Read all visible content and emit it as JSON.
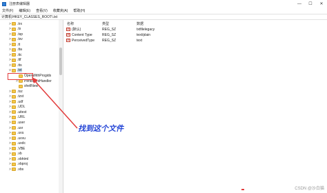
{
  "window": {
    "title": "注册表编辑器",
    "controls": {
      "minimize": "—",
      "maximize": "☐",
      "close": "✕"
    }
  },
  "menu": [
    "文件(F)",
    "编辑(E)",
    "查看(V)",
    "收藏夹(A)",
    "帮助(H)"
  ],
  "address": "计算机\\HKEY_CLASSES_ROOT\\.txt",
  "tree": {
    "items": [
      {
        "label": ".trx",
        "caret": ">"
      },
      {
        "label": ".ts",
        "caret": ">"
      },
      {
        "label": ".tsp",
        "caret": ">"
      },
      {
        "label": ".tsv",
        "caret": ">"
      },
      {
        "label": ".tt",
        "caret": ">"
      },
      {
        "label": ".tta",
        "caret": ">"
      },
      {
        "label": ".ttc",
        "caret": ">"
      },
      {
        "label": ".ttf",
        "caret": ">"
      },
      {
        "label": ".tts",
        "caret": ">"
      },
      {
        "label": ".txt",
        "caret": "v",
        "selected": true
      },
      {
        "label": "OpenWithProgids",
        "caret": "",
        "child": true
      },
      {
        "label": "PersistentHandler",
        "caret": ">",
        "child": true
      },
      {
        "label": "shellNew",
        "caret": "",
        "child": true
      },
      {
        "label": ".txz",
        "caret": ">"
      },
      {
        "label": ".tzst",
        "caret": ">"
      },
      {
        "label": ".udf",
        "caret": ">"
      },
      {
        "label": ".UDL",
        "caret": ">"
      },
      {
        "label": ".uitest",
        "caret": ">"
      },
      {
        "label": ".URL",
        "caret": ">"
      },
      {
        "label": ".user",
        "caret": ">"
      },
      {
        "label": ".usr",
        "caret": ">"
      },
      {
        "label": ".uvu",
        "caret": ">"
      },
      {
        "label": ".uvvu",
        "caret": ">"
      },
      {
        "label": ".uxdc",
        "caret": ">"
      },
      {
        "label": ".VBE",
        "caret": ">"
      },
      {
        "label": ".vb",
        "caret": ">"
      },
      {
        "label": ".vbhtml",
        "caret": ">"
      },
      {
        "label": ".vbproj",
        "caret": ">"
      },
      {
        "label": ".vbs",
        "caret": ">"
      }
    ]
  },
  "list": {
    "headers": {
      "name": "名称",
      "type": "类型",
      "data": "数据"
    },
    "rows": [
      {
        "name": "(默认)",
        "type": "REG_SZ",
        "data": "txtfilelegacy",
        "icon": "ab"
      },
      {
        "name": "Content Type",
        "type": "REG_SZ",
        "data": "text/plain",
        "icon": "ab"
      },
      {
        "name": "PerceivedType",
        "type": "REG_SZ",
        "data": "text",
        "icon": "ab"
      }
    ]
  },
  "annotation": {
    "text": "找到这个文件",
    "color": "#e23b3b",
    "text_color": "#2546d6"
  },
  "watermark": "CSDN @沙白猫",
  "colors": {
    "folder": "#f3c74b",
    "selection": "#cce4f7",
    "accent": "#2e7fd8"
  }
}
